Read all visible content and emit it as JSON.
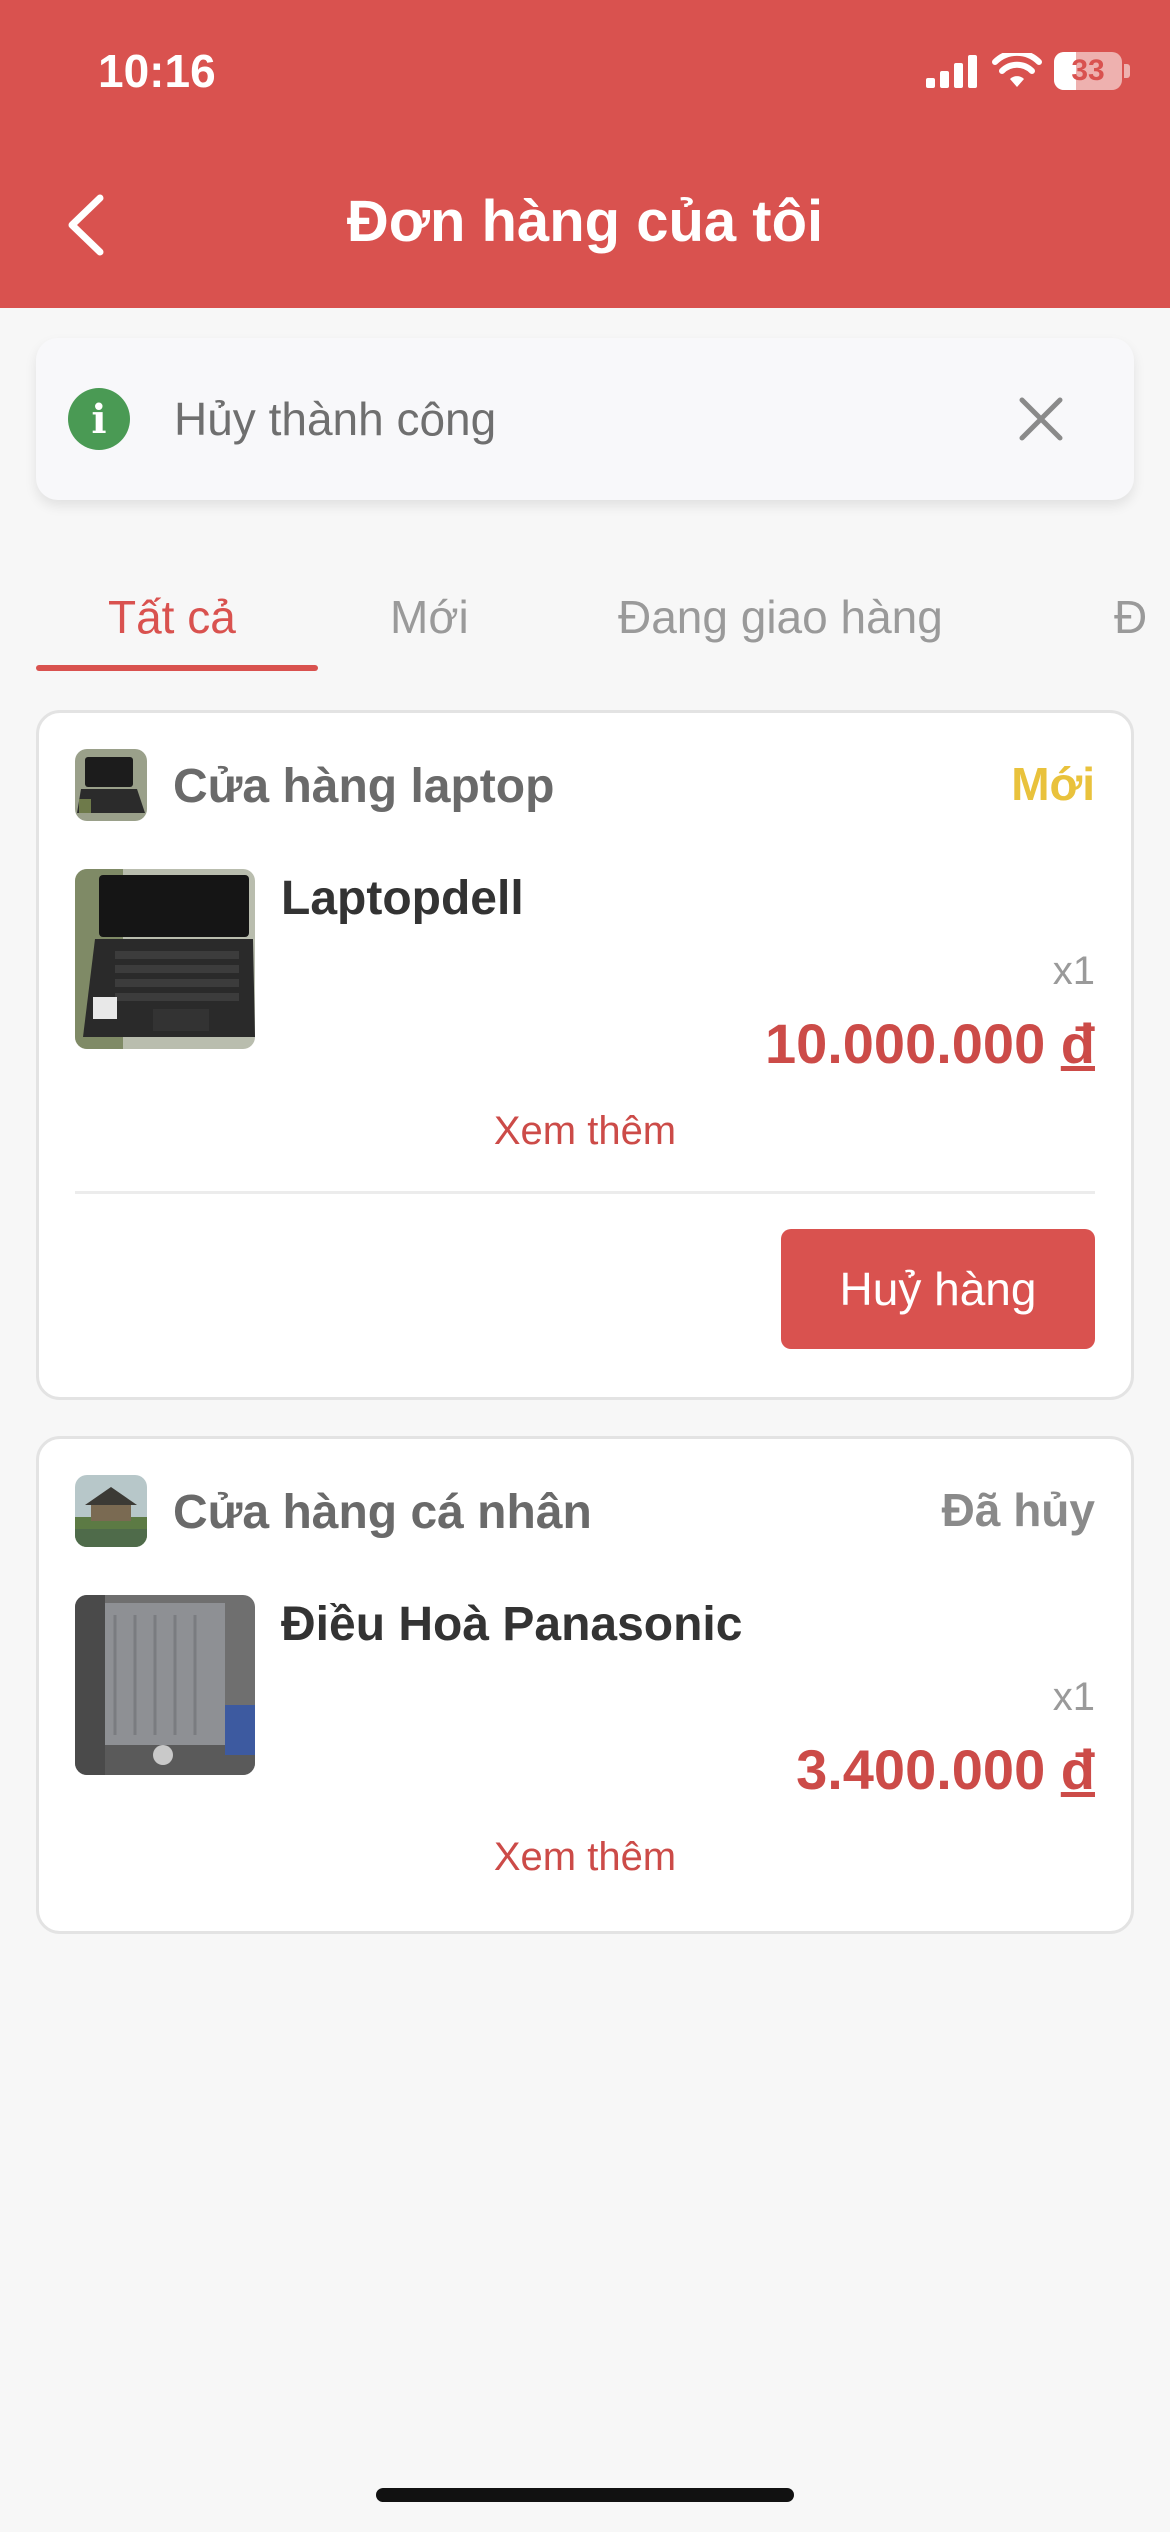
{
  "status_bar": {
    "time": "10:16",
    "battery": "33",
    "battery_level": 0.33
  },
  "header": {
    "title": "Đơn hàng của tôi"
  },
  "toast": {
    "message": "Hủy thành công"
  },
  "tabs": [
    {
      "label": "Tất cả",
      "active": true
    },
    {
      "label": "Mới",
      "active": false
    },
    {
      "label": "Đang giao hàng",
      "active": false
    },
    {
      "label": "Đ",
      "active": false
    }
  ],
  "orders": [
    {
      "store_name": "Cửa hàng laptop",
      "status": "Mới",
      "status_color": "#e9c23c",
      "product_name": "Laptopdell",
      "quantity": "x1",
      "price": "10.000.000",
      "currency": "đ",
      "see_more": "Xem thêm",
      "action_label": "Huỷ hàng"
    },
    {
      "store_name": "Cửa hàng cá nhân",
      "status": "Đã hủy",
      "status_color": "#8a8a8a",
      "product_name": "Điều Hoà Panasonic",
      "quantity": "x1",
      "price": "3.400.000",
      "currency": "đ",
      "see_more": "Xem thêm"
    }
  ],
  "colors": {
    "primary": "#d9524f",
    "success": "#4a9a54"
  }
}
